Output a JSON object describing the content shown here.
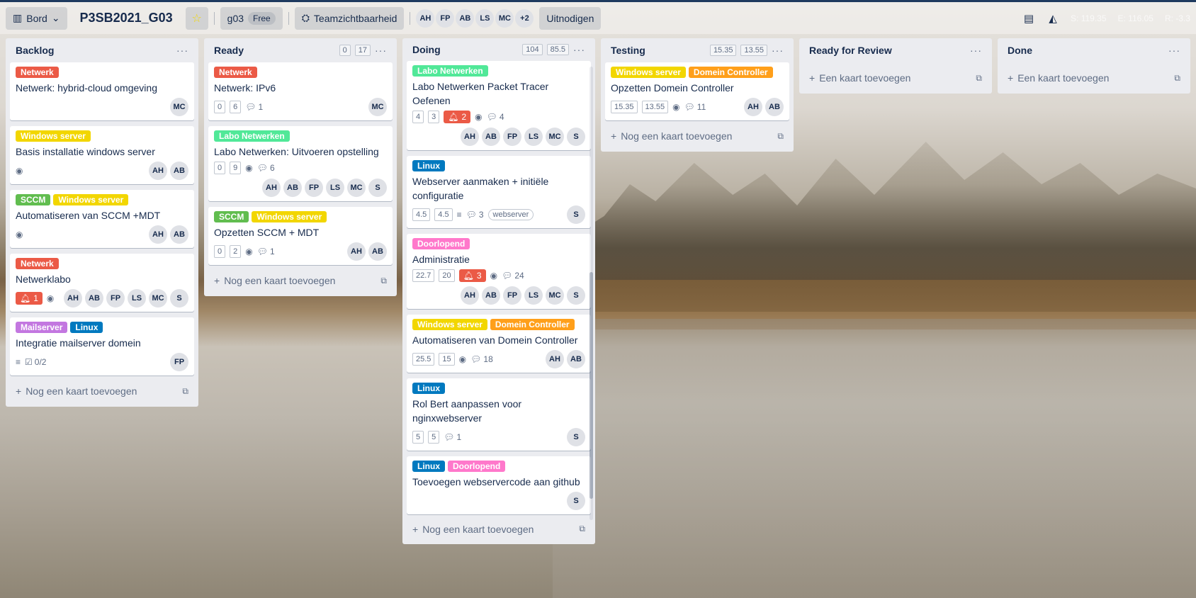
{
  "colors": {
    "Netwerk": "#eb5a46",
    "Windows server": "#f2d600",
    "SCCM": "#61bd4f",
    "Labo Netwerken": "#51e898",
    "Mailserver": "#c377e0",
    "Linux": "#0079bf",
    "Doorlopend": "#ff78cb",
    "Domein Controller": "#ff9f1a"
  },
  "topbar": {
    "view": "Bord",
    "board_title": "P3SB2021_G03",
    "workspace": "g03",
    "plan": "Free",
    "visibility": "Teamzichtbaarheid",
    "members": [
      "AH",
      "FP",
      "AB",
      "LS",
      "MC"
    ],
    "more_members": "+2",
    "invite": "Uitnodigen",
    "stats": [
      "S: 119.35",
      "E: 116.05",
      "R: -3.3"
    ]
  },
  "lists": [
    {
      "title": "Backlog",
      "badges": [],
      "add": "Nog een kaart toevoegen",
      "cards": [
        {
          "labels": [
            "Netwerk"
          ],
          "title": "Netwerk: hybrid-cloud omgeving",
          "boxes": [],
          "watch": false,
          "comments": "",
          "alert": "",
          "desc": false,
          "checklist": "",
          "tag": "",
          "members": [
            "MC"
          ]
        },
        {
          "labels": [
            "Windows server"
          ],
          "title": "Basis installatie windows server",
          "boxes": [],
          "watch": true,
          "comments": "",
          "alert": "",
          "desc": false,
          "checklist": "",
          "tag": "",
          "members": [
            "AH",
            "AB"
          ]
        },
        {
          "labels": [
            "SCCM",
            "Windows server"
          ],
          "title": "Automatiseren van SCCM +MDT",
          "boxes": [],
          "watch": true,
          "comments": "",
          "alert": "",
          "desc": false,
          "checklist": "",
          "tag": "",
          "members": [
            "AH",
            "AB"
          ]
        },
        {
          "labels": [
            "Netwerk"
          ],
          "title": "Netwerklabo",
          "boxes": [],
          "watch": true,
          "comments": "",
          "alert": "1",
          "desc": false,
          "checklist": "",
          "tag": "",
          "members": [
            "AH",
            "AB",
            "FP",
            "LS",
            "MC",
            "S"
          ]
        },
        {
          "labels": [
            "Mailserver",
            "Linux"
          ],
          "title": "Integratie mailserver domein",
          "boxes": [],
          "watch": false,
          "comments": "",
          "alert": "",
          "desc": true,
          "checklist": "0/2",
          "tag": "",
          "members": [
            "FP"
          ]
        }
      ]
    },
    {
      "title": "Ready",
      "badges": [
        "0",
        "17"
      ],
      "add": "Nog een kaart toevoegen",
      "cards": [
        {
          "labels": [
            "Netwerk"
          ],
          "title": "Netwerk: IPv6",
          "boxes": [
            "0",
            "6"
          ],
          "watch": false,
          "comments": "1",
          "alert": "",
          "desc": false,
          "checklist": "",
          "tag": "",
          "members": [
            "MC"
          ]
        },
        {
          "labels": [
            "Labo Netwerken"
          ],
          "title": "Labo Netwerken: Uitvoeren opstelling",
          "boxes": [
            "0",
            "9"
          ],
          "watch": true,
          "comments": "6",
          "alert": "",
          "desc": false,
          "checklist": "",
          "tag": "",
          "members": [
            "AH",
            "AB",
            "FP",
            "LS",
            "MC",
            "S"
          ]
        },
        {
          "labels": [
            "SCCM",
            "Windows server"
          ],
          "title": "Opzetten SCCM + MDT",
          "boxes": [
            "0",
            "2"
          ],
          "watch": true,
          "comments": "1",
          "alert": "",
          "desc": false,
          "checklist": "",
          "tag": "",
          "members": [
            "AH",
            "AB"
          ]
        }
      ]
    },
    {
      "title": "Doing",
      "badges": [
        "104",
        "85.5"
      ],
      "add": "Nog een kaart toevoegen",
      "cards": [
        {
          "labels": [
            "Labo Netwerken"
          ],
          "title": "Labo Netwerken Packet Tracer Oefenen",
          "boxes": [
            "4",
            "3"
          ],
          "watch": true,
          "comments": "4",
          "alert": "2",
          "desc": false,
          "checklist": "",
          "tag": "",
          "members": [
            "AH",
            "AB",
            "FP",
            "LS",
            "MC",
            "S"
          ]
        },
        {
          "labels": [
            "Linux"
          ],
          "title": "Webserver aanmaken + initiële configuratie",
          "boxes": [
            "4.5",
            "4.5"
          ],
          "watch": false,
          "comments": "3",
          "alert": "",
          "desc": true,
          "checklist": "",
          "tag": "webserver",
          "members": [
            "S"
          ]
        },
        {
          "labels": [
            "Doorlopend"
          ],
          "title": "Administratie",
          "boxes": [
            "22.7",
            "20"
          ],
          "watch": true,
          "comments": "24",
          "alert": "3",
          "desc": false,
          "checklist": "",
          "tag": "",
          "members": [
            "AH",
            "AB",
            "FP",
            "LS",
            "MC",
            "S"
          ]
        },
        {
          "labels": [
            "Windows server",
            "Domein Controller"
          ],
          "title": "Automatiseren van Domein Controller",
          "boxes": [
            "25.5",
            "15"
          ],
          "watch": true,
          "comments": "18",
          "alert": "",
          "desc": false,
          "checklist": "",
          "tag": "",
          "members": [
            "AH",
            "AB"
          ]
        },
        {
          "labels": [
            "Linux"
          ],
          "title": "Rol Bert aanpassen voor nginxwebserver",
          "boxes": [
            "5",
            "5"
          ],
          "watch": false,
          "comments": "1",
          "alert": "",
          "desc": false,
          "checklist": "",
          "tag": "",
          "members": [
            "S"
          ]
        },
        {
          "labels": [
            "Linux",
            "Doorlopend"
          ],
          "title": "Toevoegen webservercode aan github",
          "boxes": [],
          "watch": false,
          "comments": "",
          "alert": "",
          "desc": false,
          "checklist": "",
          "tag": "",
          "members": [
            "S"
          ]
        }
      ]
    },
    {
      "title": "Testing",
      "badges": [
        "15.35",
        "13.55"
      ],
      "add": "Nog een kaart toevoegen",
      "cards": [
        {
          "labels": [
            "Windows server",
            "Domein Controller"
          ],
          "title": "Opzetten Domein Controller",
          "boxes": [
            "15.35",
            "13.55"
          ],
          "watch": true,
          "comments": "11",
          "alert": "",
          "desc": false,
          "checklist": "",
          "tag": "",
          "members": [
            "AH",
            "AB"
          ]
        }
      ]
    },
    {
      "title": "Ready for Review",
      "badges": [],
      "add": "Een kaart toevoegen",
      "cards": []
    },
    {
      "title": "Done",
      "badges": [],
      "add": "Een kaart toevoegen",
      "cards": []
    }
  ]
}
